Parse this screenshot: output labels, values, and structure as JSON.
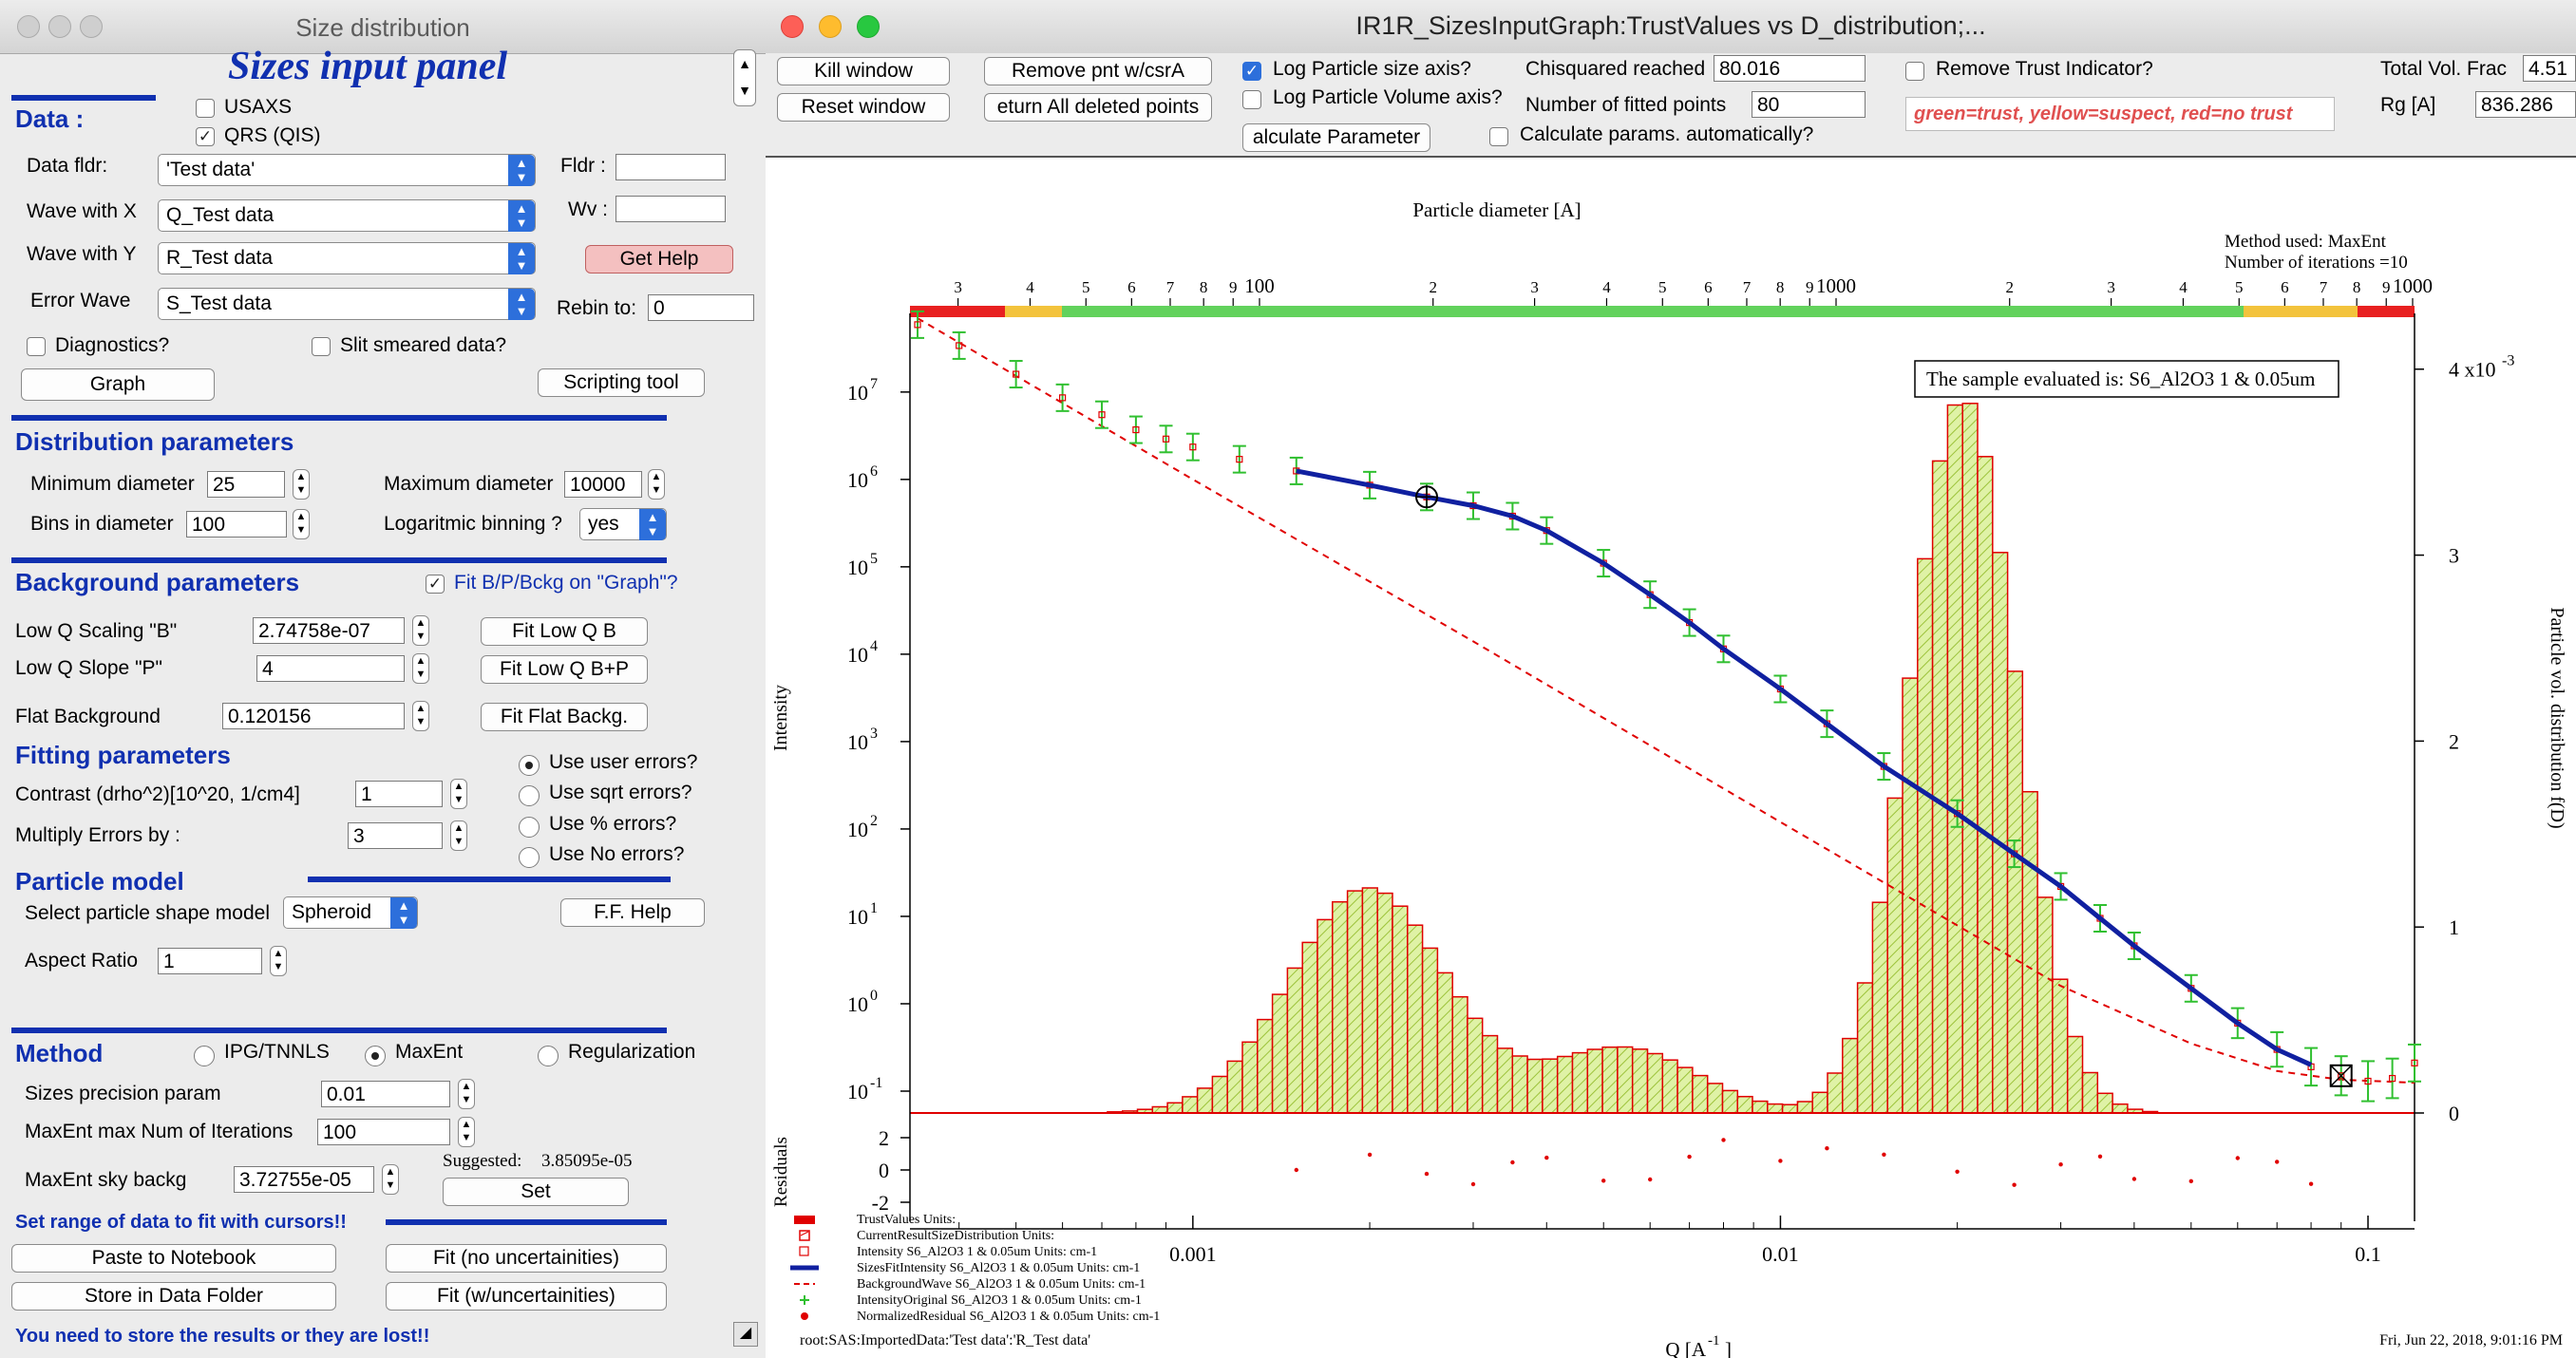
{
  "left_window": {
    "title": "Size distribution",
    "panel_title": "Sizes input panel",
    "data_header": "Data :",
    "usaxs_label": "USAXS",
    "usaxs_checked": false,
    "qrs_label": "QRS (QIS)",
    "qrs_checked": true,
    "data_fldr_label": "Data fldr:",
    "data_fldr_value": "'Test data'",
    "fldr_label": "Fldr :",
    "fldr_value": "",
    "wave_x_label": "Wave with X",
    "wave_x_value": "Q_Test data",
    "wv_label": "Wv :",
    "wv_value": "",
    "wave_y_label": "Wave with Y",
    "wave_y_value": "R_Test data",
    "get_help": "Get Help",
    "error_wave_label": "Error Wave",
    "error_wave_value": "S_Test data",
    "rebin_label": "Rebin to:",
    "rebin_value": "0",
    "diagnostics_label": "Diagnostics?",
    "slit_label": "Slit smeared data?",
    "graph_button": "Graph",
    "scripting_button": "Scripting tool",
    "dist_header": "Distribution parameters",
    "min_diam_label": "Minimum diameter",
    "min_diam_value": "25",
    "max_diam_label": "Maximum diameter",
    "max_diam_value": "10000",
    "bins_label": "Bins in diameter",
    "bins_value": "100",
    "log_binning_label": "Logaritmic binning ?",
    "log_binning_value": "yes",
    "bg_header": "Background parameters",
    "fit_bpb_label": "Fit B/P/Bckg on \"Graph\"?",
    "fit_bpb_checked": true,
    "lowq_scaling_label": "Low Q Scaling  \"B\"",
    "lowq_scaling_value": "2.74758e-07",
    "fit_lowq_b": "Fit Low Q B",
    "lowq_slope_label": "Low Q Slope   \"P\"",
    "lowq_slope_value": "4",
    "fit_lowq_bp": "Fit Low Q B+P",
    "flat_bg_label": "Flat Background",
    "flat_bg_value": "0.120156",
    "fit_flat": "Fit Flat Backg.",
    "fitting_header": "Fitting parameters",
    "use_user_errors": "Use user errors?",
    "use_sqrt_errors": "Use sqrt errors?",
    "use_pct_errors": "Use % errors?",
    "use_no_errors": "Use No errors?",
    "contrast_label": "Contrast (drho^2)[10^20, 1/cm4]",
    "contrast_value": "1",
    "mult_errors_label": "Multiply Errors by :",
    "mult_errors_value": "3",
    "particle_header": "Particle model",
    "shape_label": "Select particle shape model",
    "shape_value": "Spheroid",
    "ff_help": "F.F. Help",
    "aspect_label": "Aspect Ratio",
    "aspect_value": "1",
    "method_header": "Method",
    "method_ipg": "IPG/TNNLS",
    "method_maxent": "MaxEnt",
    "method_reg": "Regularization",
    "precision_label": "Sizes precision param",
    "precision_value": "0.01",
    "maxent_iter_label": "MaxEnt max Num of Iterations",
    "maxent_iter_value": "100",
    "sky_label": "MaxEnt sky backg",
    "sky_value": "3.72755e-05",
    "suggested_label": "Suggested:",
    "suggested_value": "3.85095e-05",
    "set_button": "Set",
    "cursor_label": "Set range of data to fit with cursors!!",
    "paste_button": "Paste to Notebook",
    "fit_nounc_button": "Fit (no uncertainities)",
    "store_button": "Store in Data Folder",
    "fit_unc_button": "Fit (w/uncertainities)",
    "warning": "You need to store the results or they are lost!!"
  },
  "right_window": {
    "title": "IR1R_SizesInputGraph:TrustValues vs D_distribution;...",
    "kill_window": "Kill window",
    "reset_window": "Reset window",
    "remove_pnt": "Remove pnt w/csrA",
    "return_deleted": "eturn All deleted points",
    "log_size_label": "Log Particle size axis?",
    "log_size_checked": true,
    "log_volume_label": "Log Particle Volume axis?",
    "log_volume_checked": false,
    "calc_param_button": "alculate Parameter",
    "chisq_label": "Chisquared reached",
    "chisq_value": "80.016",
    "npts_label": "Number of fitted points",
    "npts_value": "80",
    "calc_auto_label": "Calculate params. automatically?",
    "remove_trust_label": "Remove Trust Indicator?",
    "trust_legend": "green=trust, yellow=suspect, red=no trust",
    "total_vol_label": "Total Vol. Frac",
    "total_vol_value": "4.51",
    "rg_label": "Rg [A]",
    "rg_value": "836.286"
  },
  "chart_data": {
    "type": "scatter",
    "top_axis_label": "Particle diameter [A]",
    "top_axis_ticks": [
      "3",
      "4",
      "5",
      "6",
      "7",
      "8",
      "9",
      "100",
      "2",
      "3",
      "4",
      "5",
      "6",
      "7",
      "8",
      "9",
      "1000",
      "2",
      "3",
      "4",
      "5",
      "6",
      "7",
      "8",
      "9",
      "1000"
    ],
    "method_text": "Method used: MaxEnt",
    "iterations_text": "Number of iterations =10",
    "sample_text": "The sample evaluated is:  S6_Al2O3 1 & 0.05um",
    "ylabel_left": "Intensity",
    "ylabel_right": "Particle vol. distribution f(D)",
    "residuals_label": "Residuals",
    "xlabel": "Q [A",
    "xlabel_exp": "-1",
    "xlabel_close": "]",
    "left_ticks": [
      {
        "base": "10",
        "exp": "7",
        "v": 7
      },
      {
        "base": "10",
        "exp": "6",
        "v": 6
      },
      {
        "base": "10",
        "exp": "5",
        "v": 5
      },
      {
        "base": "10",
        "exp": "4",
        "v": 4
      },
      {
        "base": "10",
        "exp": "3",
        "v": 3
      },
      {
        "base": "10",
        "exp": "2",
        "v": 2
      },
      {
        "base": "10",
        "exp": "1",
        "v": 1
      },
      {
        "base": "10",
        "exp": "0",
        "v": 0
      },
      {
        "base": "10",
        "exp": "-1",
        "v": -1
      }
    ],
    "right_ticks": [
      {
        "label": "4 x10",
        "exp": "-3",
        "v": 4
      },
      {
        "label": "3",
        "v": 3
      },
      {
        "label": "2",
        "v": 2
      },
      {
        "label": "1",
        "v": 1
      },
      {
        "label": "0",
        "v": 0
      }
    ],
    "residual_ticks": [
      "2",
      "0",
      "-2"
    ],
    "x_ticks": [
      "0.001",
      "0.01",
      "0.1"
    ],
    "xlim": [
      0.00033,
      0.12
    ],
    "ylim_log": [
      -1.25,
      7.9
    ],
    "ylim_right": [
      0,
      4.3
    ],
    "distribution": {
      "diameter_range": [
        25,
        10000
      ],
      "bins": 100,
      "peaks": [
        {
          "diameter": 154,
          "fD": 1.21
        },
        {
          "diameter": 1660,
          "fD": 3.85
        }
      ]
    },
    "intensity_original": [
      [
        0.00034,
        59000000.0
      ],
      [
        0.0004,
        34000000.0
      ],
      [
        0.0005,
        16000000.0
      ],
      [
        0.0006,
        8600000.0
      ],
      [
        0.0007,
        5500000.0
      ],
      [
        0.0008,
        3700000.0
      ],
      [
        0.0009,
        2900000.0
      ],
      [
        0.001,
        2350000.0
      ],
      [
        0.0012,
        1700000.0
      ],
      [
        0.0015,
        1250000.0
      ],
      [
        0.002,
        860000.0
      ],
      [
        0.0025,
        630000.0
      ],
      [
        0.003,
        500000.0
      ],
      [
        0.0035,
        380000.0
      ],
      [
        0.004,
        260000.0
      ],
      [
        0.005,
        110000.0
      ],
      [
        0.006,
        48000.0
      ],
      [
        0.007,
        23000.0
      ],
      [
        0.008,
        11500.0
      ],
      [
        0.01,
        4000.0
      ],
      [
        0.012,
        1600.0
      ],
      [
        0.015,
        520.0
      ],
      [
        0.02,
        150.0
      ],
      [
        0.025,
        52
      ],
      [
        0.03,
        22
      ],
      [
        0.035,
        9.5
      ],
      [
        0.04,
        4.6
      ],
      [
        0.05,
        1.5
      ],
      [
        0.06,
        0.6
      ],
      [
        0.07,
        0.3
      ],
      [
        0.08,
        0.19
      ],
      [
        0.09,
        0.15
      ],
      [
        0.1,
        0.13
      ],
      [
        0.11,
        0.14
      ],
      [
        0.12,
        0.21
      ]
    ],
    "sizes_fit_intensity": [
      [
        0.0015,
        1250000.0
      ],
      [
        0.002,
        860000.0
      ],
      [
        0.0025,
        630000.0
      ],
      [
        0.003,
        500000.0
      ],
      [
        0.0035,
        380000.0
      ],
      [
        0.004,
        260000.0
      ],
      [
        0.005,
        110000.0
      ],
      [
        0.006,
        48000.0
      ],
      [
        0.007,
        23000.0
      ],
      [
        0.008,
        11500.0
      ],
      [
        0.01,
        4000.0
      ],
      [
        0.012,
        1600.0
      ],
      [
        0.015,
        520.0
      ],
      [
        0.02,
        150.0
      ],
      [
        0.025,
        52
      ],
      [
        0.03,
        22
      ],
      [
        0.035,
        9.5
      ],
      [
        0.04,
        4.6
      ],
      [
        0.05,
        1.5
      ],
      [
        0.06,
        0.6
      ],
      [
        0.07,
        0.3
      ],
      [
        0.08,
        0.2
      ]
    ],
    "background_wave": [
      [
        0.00034,
        70000000.0
      ],
      [
        0.001,
        1000000.0
      ],
      [
        0.003,
        14000.0
      ],
      [
        0.01,
        120.0
      ],
      [
        0.03,
        1.6
      ],
      [
        0.05,
        0.35
      ],
      [
        0.07,
        0.17
      ],
      [
        0.09,
        0.135
      ],
      [
        0.12,
        0.125
      ]
    ],
    "legend": [
      {
        "name": "TrustValues   Units:",
        "color": "#e00000"
      },
      {
        "name": "CurrentResultSizeDistribution   Units:",
        "color": "#e00000"
      },
      {
        "name": "Intensity   S6_Al2O3 1 & 0.05um  Units: cm-1",
        "color": "#e00000"
      },
      {
        "name": "SizesFitIntensity   S6_Al2O3 1 & 0.05um  Units: cm-1",
        "color": "#1020a0"
      },
      {
        "name": "BackgroundWave   S6_Al2O3 1 & 0.05um  Units: cm-1",
        "color": "#e00000"
      },
      {
        "name": "IntensityOriginal   S6_Al2O3 1 & 0.05um  Units: cm-1",
        "color": "#30c030"
      },
      {
        "name": "NormalizedResidual   S6_Al2O3 1 & 0.05um  Units: cm-1",
        "color": "#e00000"
      }
    ],
    "footer_left": "root:SAS:ImportedData:'Test data':'R_Test data'",
    "footer_right": "Fri, Jun 22, 2018, 9:01:16 PM"
  }
}
